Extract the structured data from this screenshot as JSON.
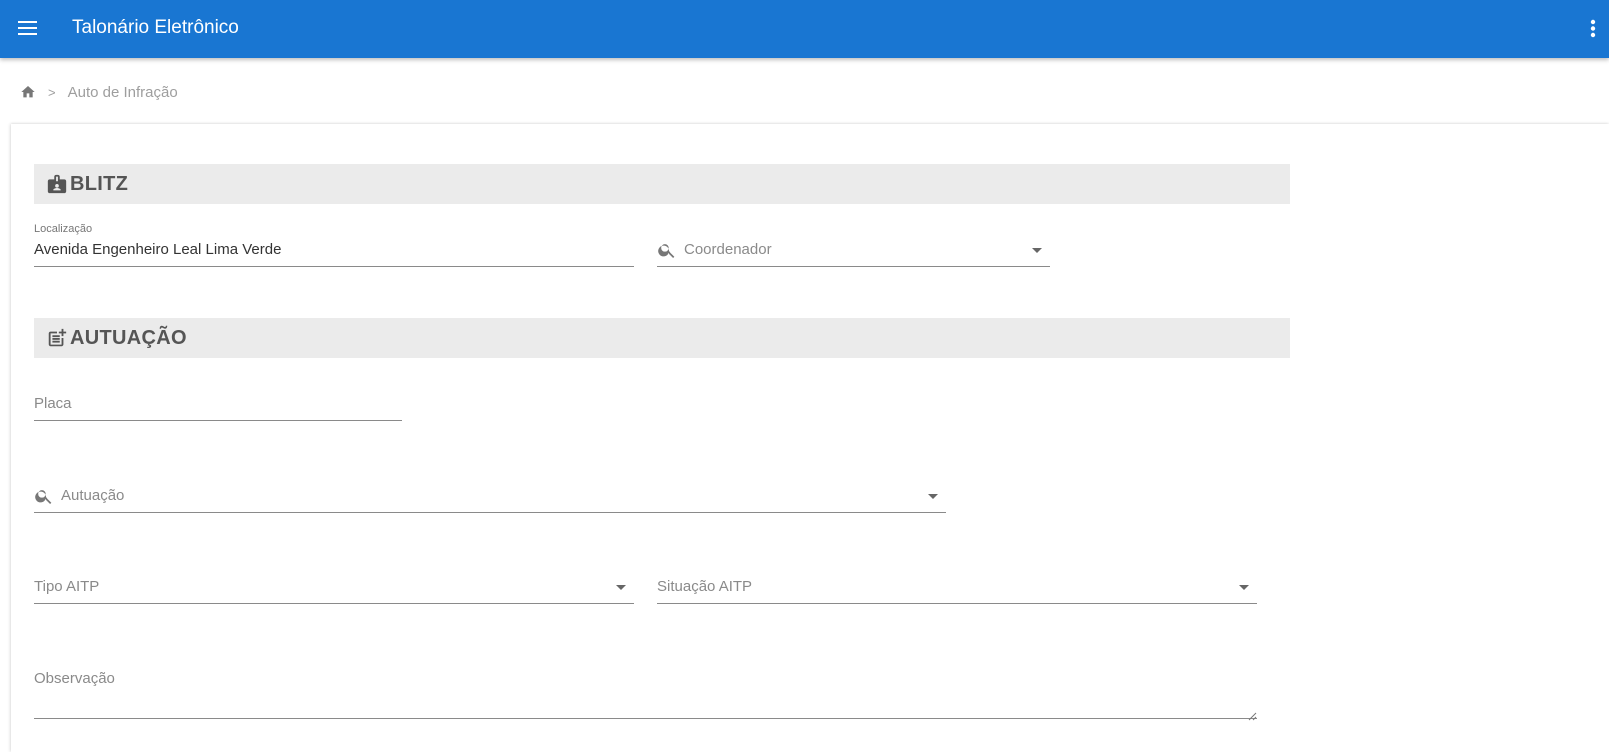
{
  "app": {
    "title": "Talonário Eletrônico",
    "menu_icon": "hamburger-menu-icon",
    "more_icon": "more-vert-icon",
    "brand_color": "#1976d2"
  },
  "breadcrumb": {
    "home_icon": "home-icon",
    "separator": ">",
    "current": "Auto de Infração"
  },
  "sections": {
    "blitz": {
      "title": "BLITZ",
      "icon": "badge-icon"
    },
    "autuacao": {
      "title": "AUTUAÇÃO",
      "icon": "post-add-icon"
    }
  },
  "fields": {
    "localizacao": {
      "label": "Localização",
      "value": "Avenida Engenheiro Leal Lima Verde"
    },
    "coordenador": {
      "placeholder": "Coordenador"
    },
    "placa": {
      "placeholder": "Placa"
    },
    "autuacao": {
      "placeholder": "Autuação"
    },
    "tipo_aitp": {
      "placeholder": "Tipo AITP"
    },
    "situacao_aitp": {
      "placeholder": "Situação AITP"
    },
    "observacao": {
      "placeholder": "Observação"
    }
  }
}
